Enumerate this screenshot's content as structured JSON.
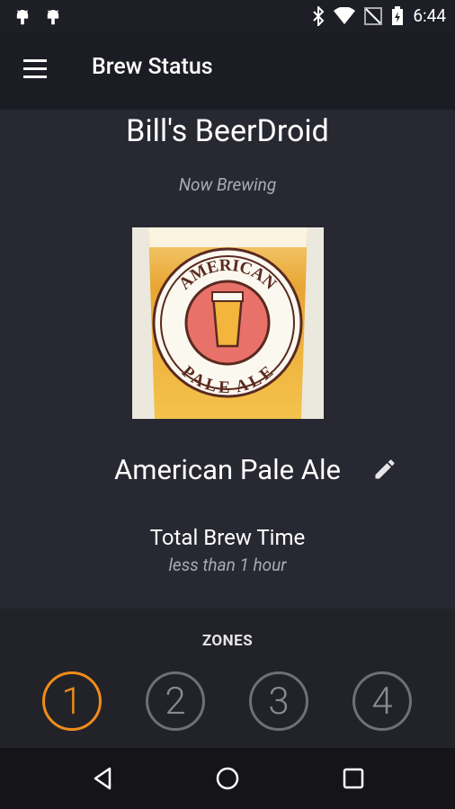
{
  "status_bar": {
    "time": "6:44",
    "left_icons": [
      "android-icon",
      "android-icon"
    ],
    "right_icons": [
      "bluetooth-icon",
      "wifi-icon",
      "no-signal-icon",
      "battery-charging-icon"
    ]
  },
  "toolbar": {
    "title": "Brew Status"
  },
  "main": {
    "brewer_name": "Bill's BeerDroid",
    "now_brewing_label": "Now Brewing",
    "beer_image_text_top": "AMERICAN",
    "beer_image_text_bottom": "PALE ALE",
    "beer_name": "American Pale Ale",
    "total_brew_time_label": "Total Brew Time",
    "total_brew_time_value": "less than 1 hour"
  },
  "zones": {
    "title": "ZONES",
    "items": [
      {
        "label": "1",
        "active": true
      },
      {
        "label": "2",
        "active": false
      },
      {
        "label": "3",
        "active": false
      },
      {
        "label": "4",
        "active": false
      }
    ]
  },
  "nav_bar": {
    "buttons": [
      "back-icon",
      "home-icon",
      "recents-icon"
    ]
  },
  "colors": {
    "accent": "#f08c1a",
    "background": "#272832",
    "toolbar": "#1c1d24"
  }
}
